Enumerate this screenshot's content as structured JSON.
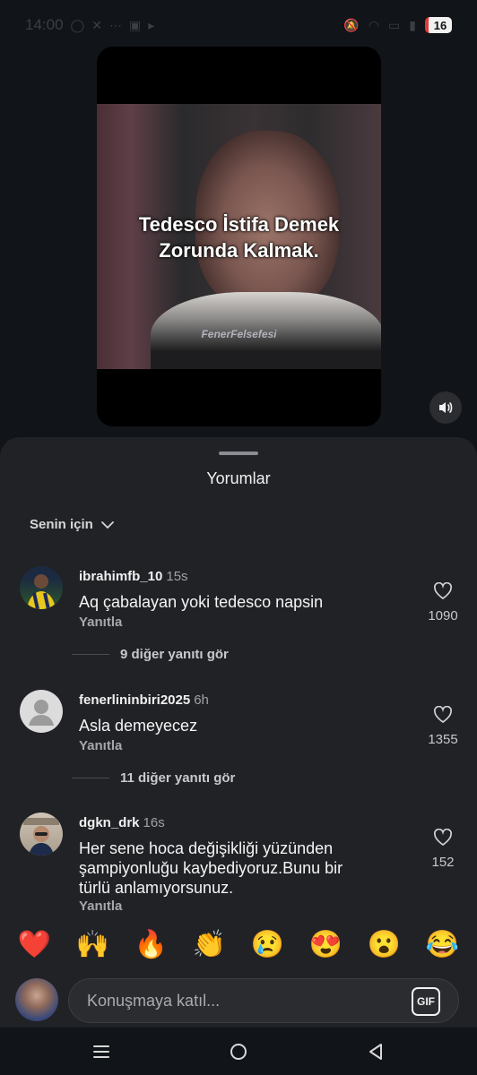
{
  "status_bar": {
    "time": "14:00",
    "battery": "16"
  },
  "video": {
    "caption_line1": "Tedesco İstifa Demek",
    "caption_line2": "Zorunda Kalmak.",
    "watermark": "FenerFelsefesi"
  },
  "sheet": {
    "title": "Yorumlar",
    "sort_label": "Senin için"
  },
  "comments": [
    {
      "username": "ibrahimfb_10",
      "time": "15s",
      "text": "Aq çabalayan yoki tedesco napsin",
      "reply_label": "Yanıtla",
      "likes": "1090",
      "more_replies": "9 diğer yanıtı gör"
    },
    {
      "username": "fenerlininbiri2025",
      "time": "6h",
      "text": "Asla demeyecez",
      "reply_label": "Yanıtla",
      "likes": "1355",
      "more_replies": "11 diğer yanıtı gör"
    },
    {
      "username": "dgkn_drk",
      "time": "16s",
      "text": "Her sene hoca değişikliği yüzünden şampiyonluğu kaybediyoruz.Bunu bir türlü anlamıyorsunuz.",
      "reply_label": "Yanıtla",
      "likes": "152"
    }
  ],
  "emojis": [
    "❤️",
    "🙌",
    "🔥",
    "👏",
    "😢",
    "😍",
    "😮",
    "😂"
  ],
  "composer": {
    "placeholder": "Konuşmaya katıl...",
    "gif_label": "GIF"
  },
  "colors": {
    "sheet_bg": "#212226",
    "page_bg": "#111418",
    "battery_low": "#e23b3b"
  }
}
